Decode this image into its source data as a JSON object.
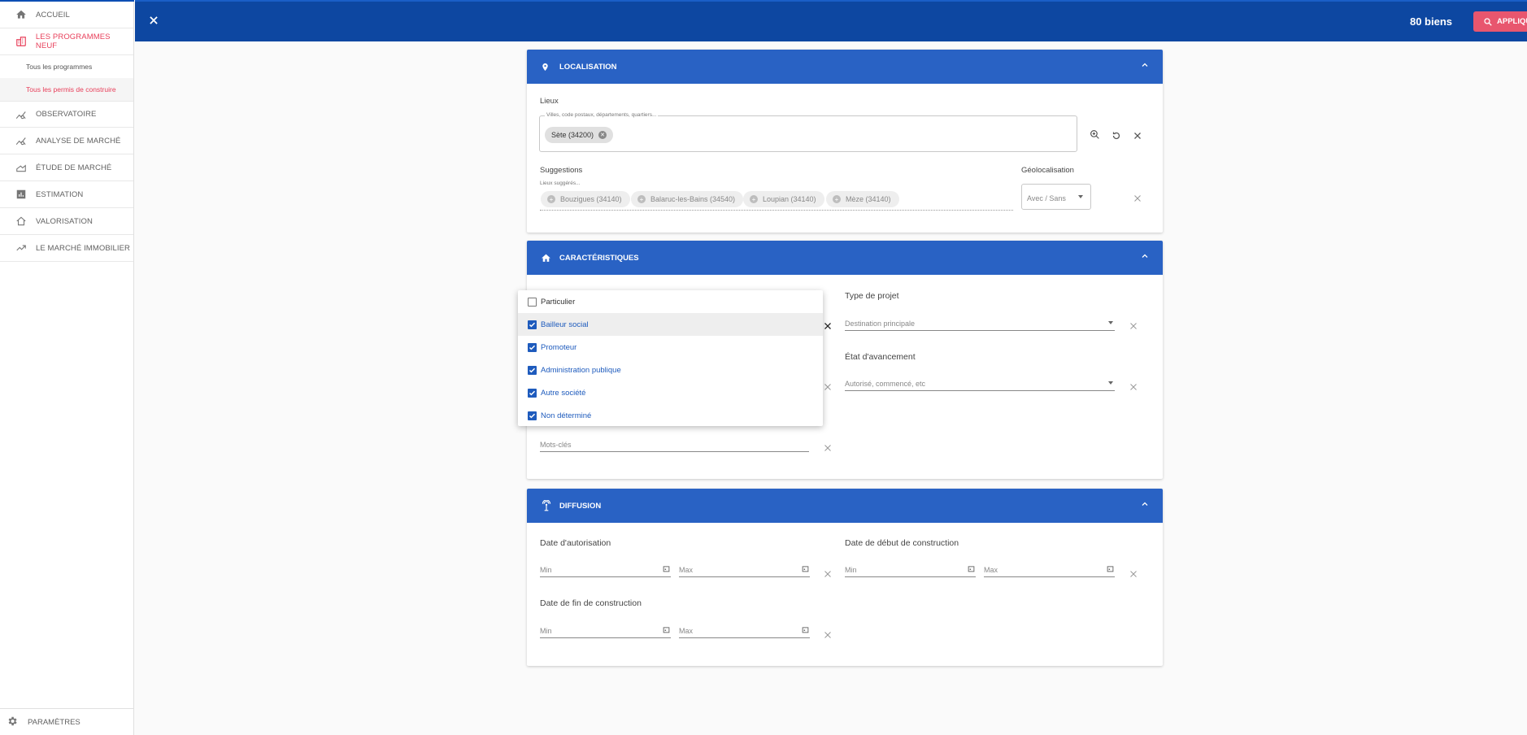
{
  "sidebar": {
    "items": [
      {
        "label": "ACCUEIL",
        "icon": "home-icon"
      },
      {
        "label": "LES PROGRAMMES NEUF",
        "icon": "building-icon"
      },
      {
        "label": "OBSERVATOIRE",
        "icon": "chart-line-icon"
      },
      {
        "label": "ANALYSE DE MARCHÉ",
        "icon": "chart-line-icon"
      },
      {
        "label": "ÉTUDE DE MARCHÉ",
        "icon": "area-chart-icon"
      },
      {
        "label": "ESTIMATION",
        "icon": "bar-chart-icon"
      },
      {
        "label": "VALORISATION",
        "icon": "house-outline-icon"
      },
      {
        "label": "LE MARCHÉ IMMOBILIER",
        "icon": "trending-up-icon"
      }
    ],
    "subitems": [
      "Tous les programmes",
      "Tous les permis de construire"
    ],
    "settings_label": "PARAMÈTRES"
  },
  "topbar": {
    "count": "80 biens",
    "apply_label": "APPLIQU"
  },
  "localisation": {
    "title": "LOCALISATION",
    "lieux_label": "Lieux",
    "lieux_placeholder": "Villes, code postaux, départements, quartiers...",
    "selected_chip": "Sète (34200)",
    "suggestions_label": "Suggestions",
    "suggested_places_label": "Lieux suggérés...",
    "suggestions": [
      "Bouzigues (34140)",
      "Balaruc-les-Bains (34540)",
      "Loupian (34140)",
      "Mèze (34140)"
    ],
    "geoloc_label": "Géolocalisation",
    "geoloc_value": "Avec / Sans"
  },
  "caracteristiques": {
    "title": "CARACTÉRISTIQUES",
    "type_projet_label": "Type de projet",
    "type_projet_placeholder": "Destination principale",
    "etat_label": "État d'avancement",
    "etat_placeholder": "Autorisé, commencé, etc",
    "motscles_placeholder": "Mots-clés",
    "options": [
      {
        "label": "Particulier",
        "checked": false
      },
      {
        "label": "Bailleur social",
        "checked": true
      },
      {
        "label": "Promoteur",
        "checked": true
      },
      {
        "label": "Administration publique",
        "checked": true
      },
      {
        "label": "Autre société",
        "checked": true
      },
      {
        "label": "Non déterminé",
        "checked": true
      }
    ]
  },
  "diffusion": {
    "title": "DIFFUSION",
    "date_autorisation_label": "Date d'autorisation",
    "date_debut_label": "Date de début de construction",
    "date_fin_label": "Date de fin de construction",
    "min_label": "Min",
    "max_label": "Max"
  },
  "colors": {
    "primary": "#0d47a1",
    "card_header": "#2962c4",
    "accent": "#e8405b",
    "checkbox": "#1e5bbd"
  }
}
